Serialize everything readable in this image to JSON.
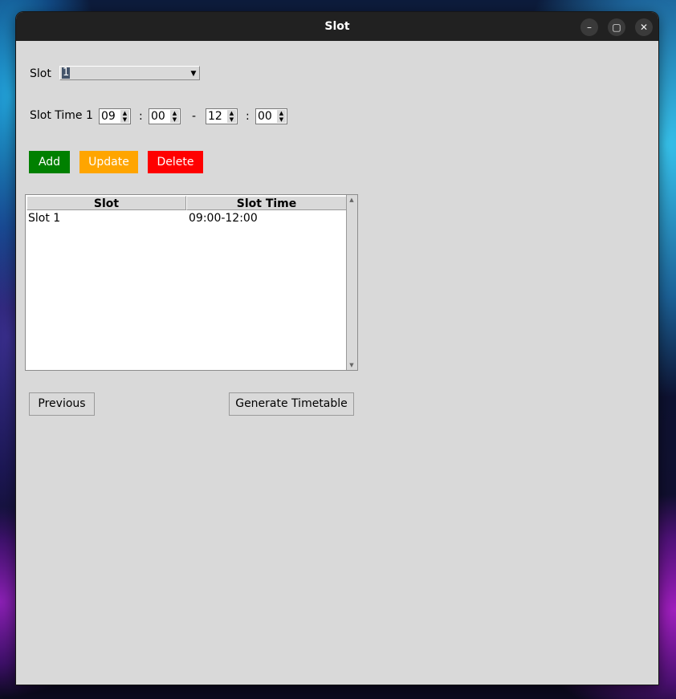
{
  "window": {
    "title": "Slot"
  },
  "controls": {
    "minimize": "–",
    "maximize": "▢",
    "close": "✕"
  },
  "form": {
    "slot_label": "Slot",
    "slot_value": "1",
    "slot_time_label": "Slot Time 1",
    "start_hour": "09",
    "start_minute": "00",
    "end_hour": "12",
    "end_minute": "00",
    "colon": ":",
    "dash": "-"
  },
  "actions": {
    "add": "Add",
    "update": "Update",
    "delete": "Delete",
    "colors": {
      "add": "#008000",
      "update": "#ffa500",
      "delete": "#ff0000"
    }
  },
  "table": {
    "columns": [
      "Slot",
      "Slot Time"
    ],
    "rows": [
      {
        "slot": "Slot 1",
        "time": "09:00-12:00"
      }
    ]
  },
  "nav": {
    "previous": "Previous",
    "generate": "Generate Timetable"
  }
}
